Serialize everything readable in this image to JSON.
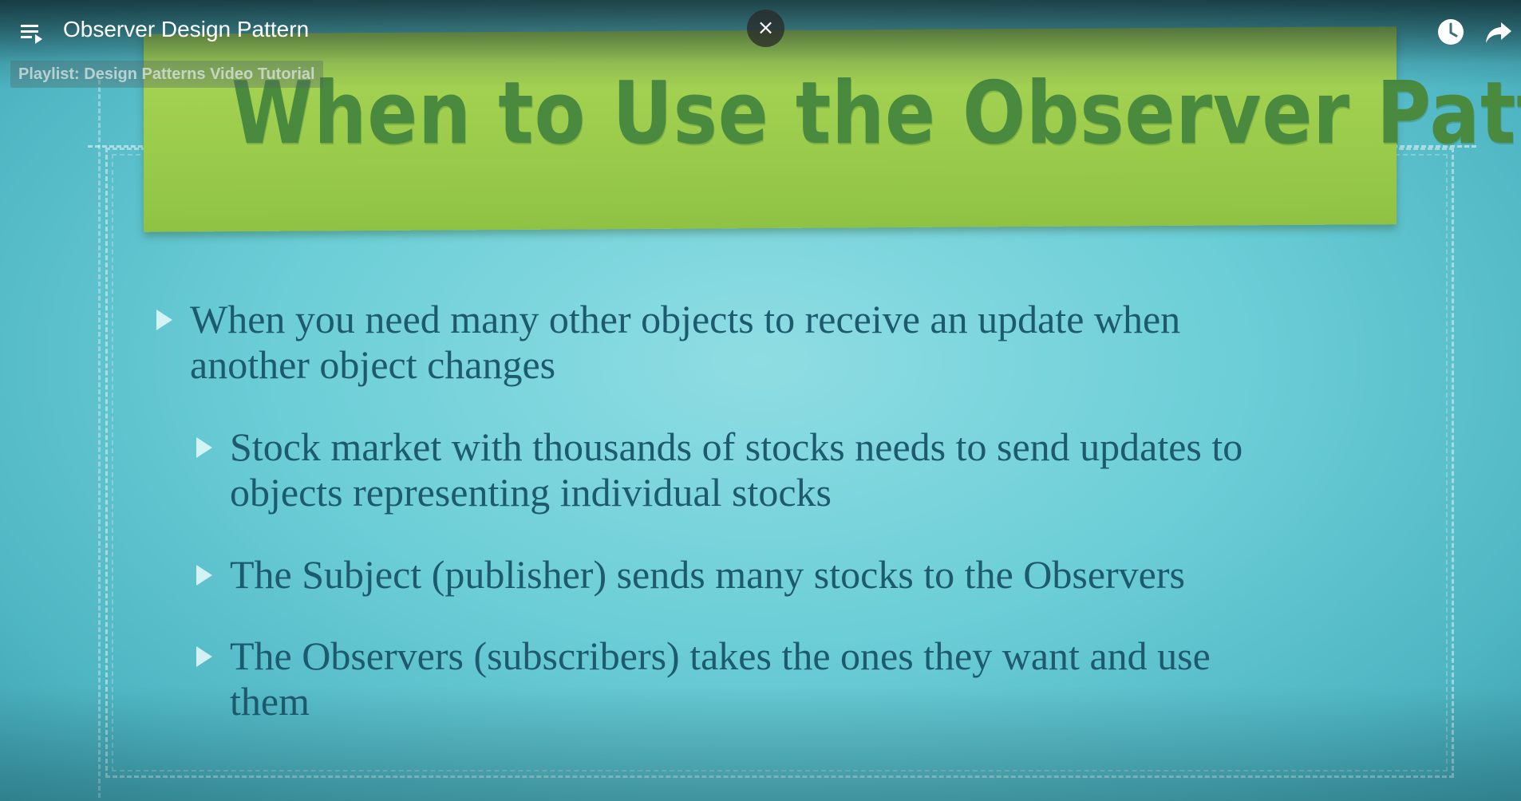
{
  "player": {
    "video_title": "Observer Design Pattern",
    "playlist_label": "Playlist: Design Patterns Video Tutorial",
    "close_label": "×",
    "icons": [
      "playlist-icon",
      "close-icon",
      "watch-later-clock-icon",
      "share-arrow-icon"
    ]
  },
  "slide": {
    "title": "When to Use the Observer Pattern",
    "bullets": [
      {
        "level": 1,
        "line1": "When you need many other objects to receive an update when",
        "line2": "another object changes"
      },
      {
        "level": 2,
        "line1": "Stock market with thousands of stocks needs to send updates to",
        "line2": "objects representing individual stocks"
      },
      {
        "level": 2,
        "line1": "The Subject (publisher) sends many stocks to the Observers",
        "line2": ""
      },
      {
        "level": 2,
        "line1": "The Observers (subscribers) takes the ones they want and use",
        "line2": "them"
      }
    ],
    "colors": {
      "background": "#6cced7",
      "banner": "#9ccc4c",
      "title_text": "#4a8a3f",
      "body_text": "#1d5a6e"
    }
  }
}
